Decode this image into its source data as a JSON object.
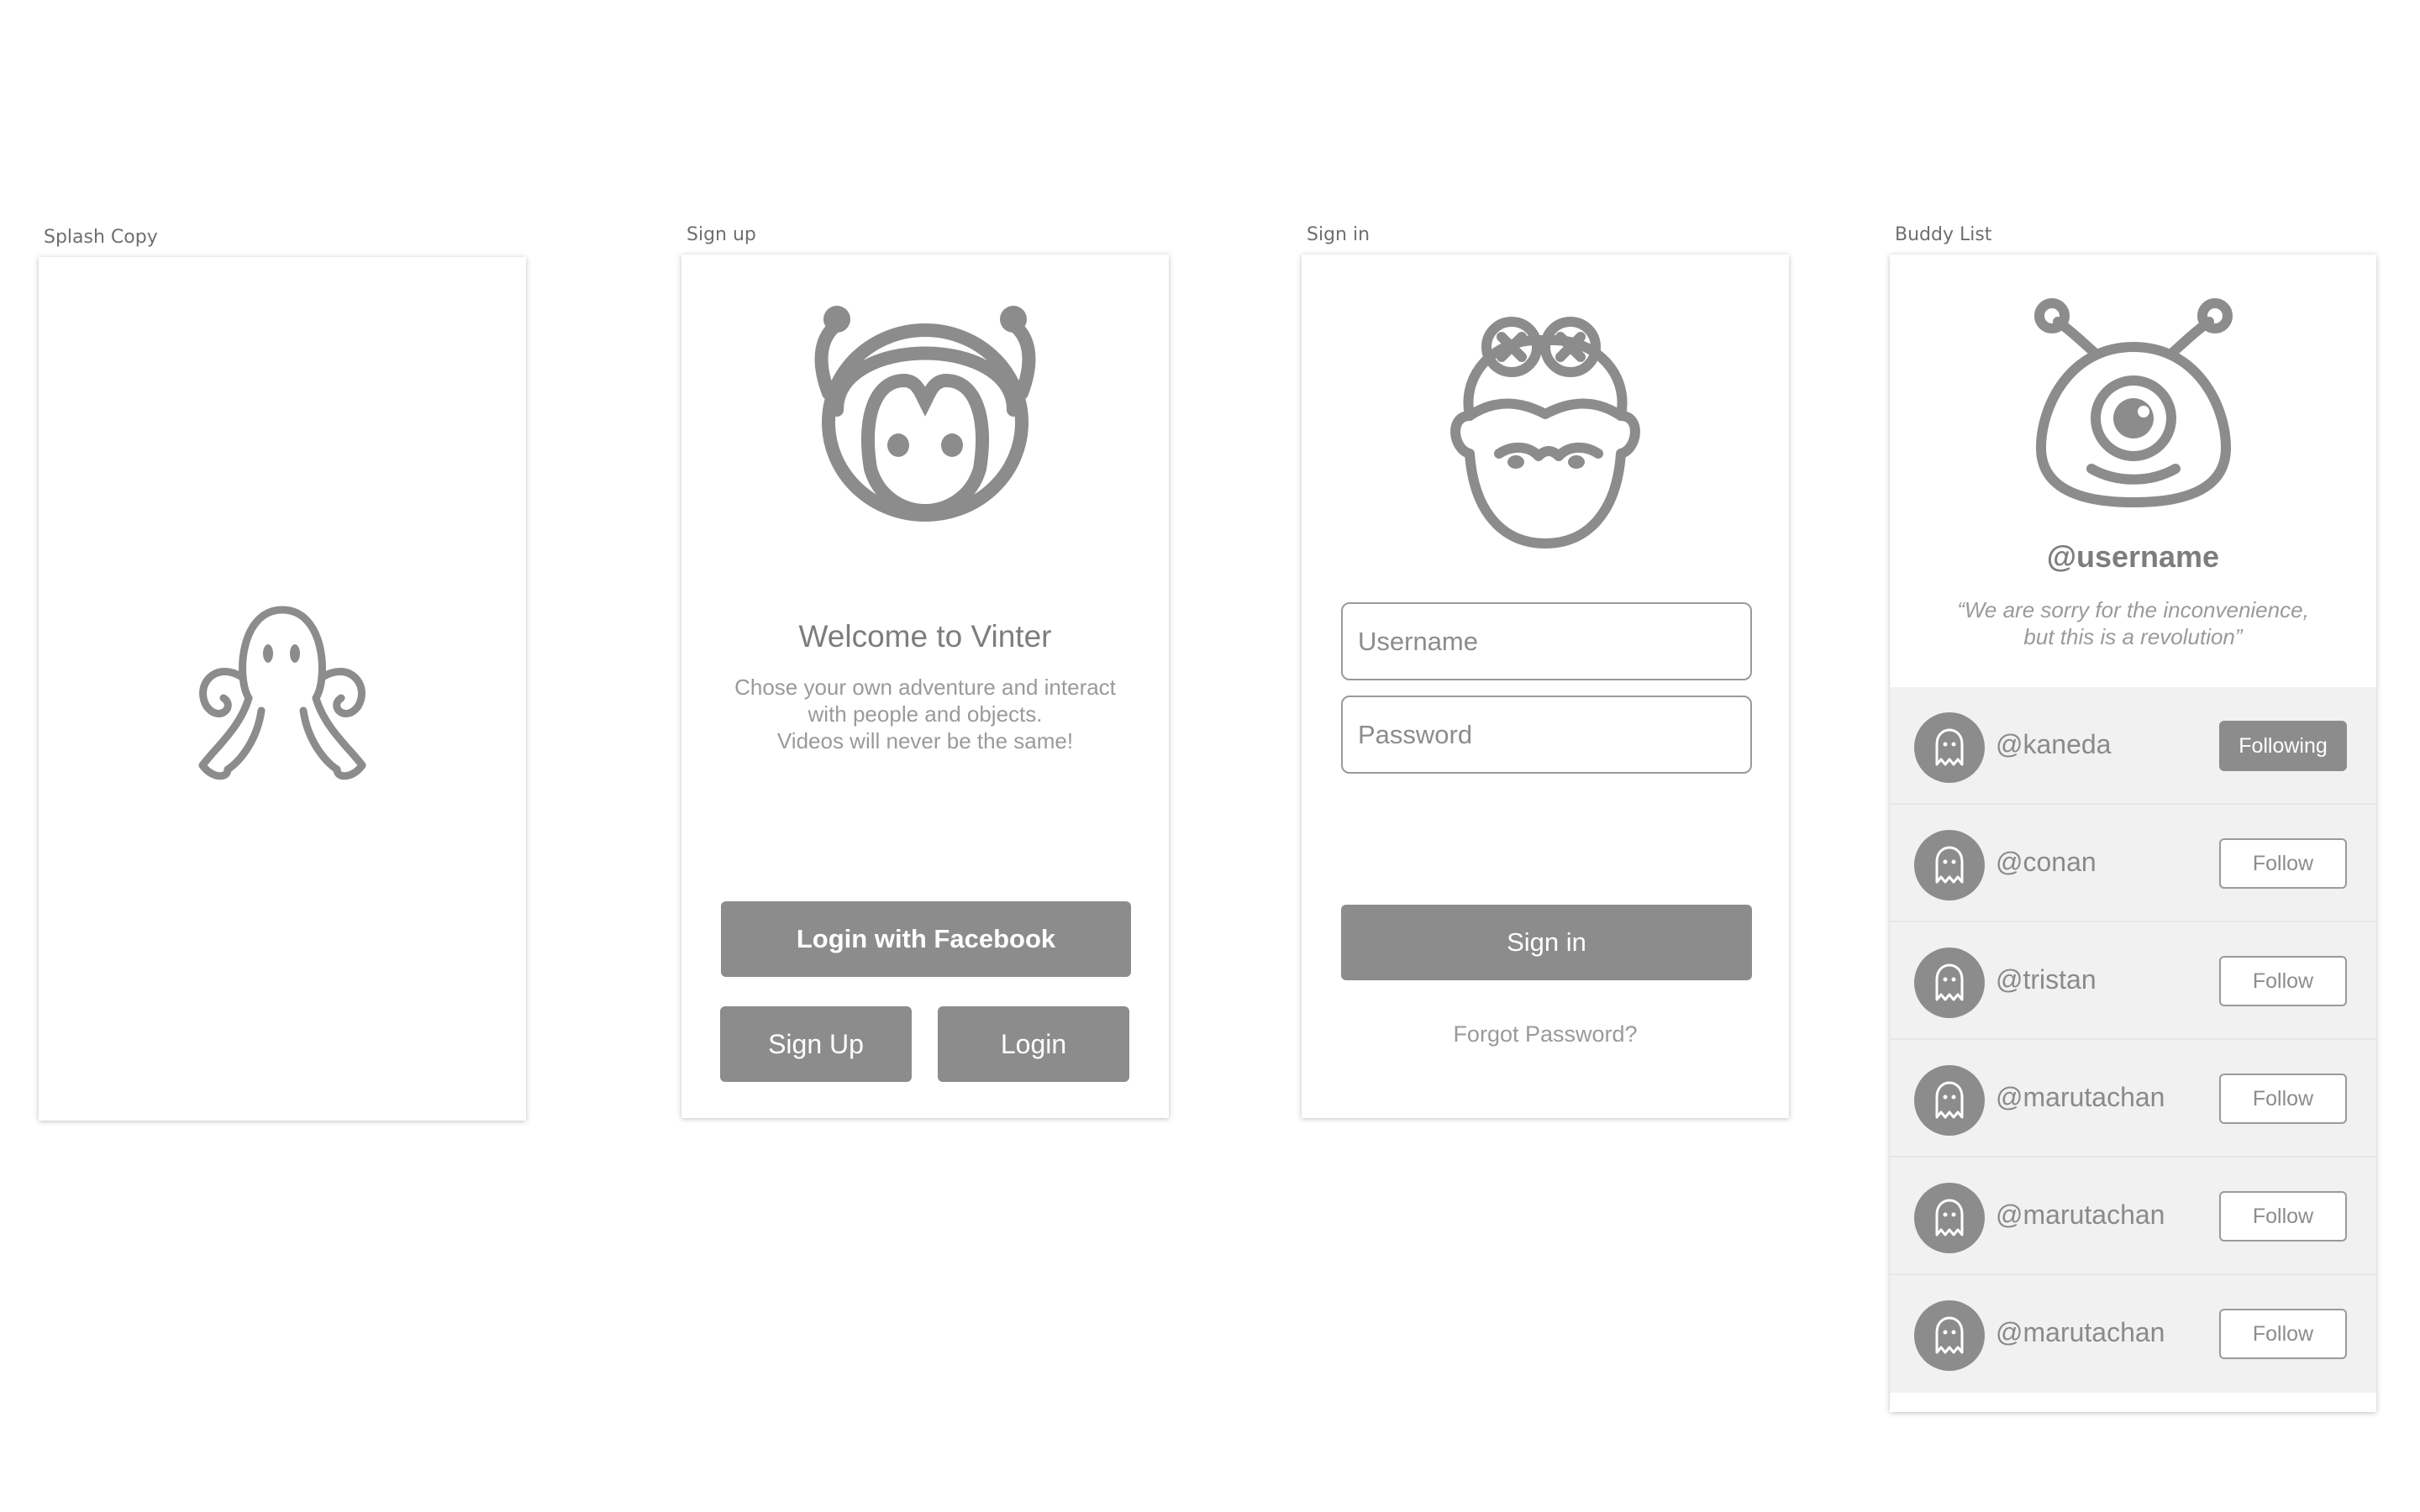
{
  "colors": {
    "primary_gray": "#8c8c8c",
    "row_bg": "#f1f1f1",
    "canvas_bg": "#ffffff"
  },
  "artboards": {
    "splash": {
      "label": "Splash Copy",
      "icon": "octopus-icon"
    },
    "signup": {
      "label": "Sign up",
      "icon": "monkey-mascot-icon",
      "title": "Welcome to Vinter",
      "description_line1": "Chose your own adventure and interact",
      "description_line2": "with people and objects.",
      "description_line3": "Videos will never be the same!",
      "facebook_button": "Login with Facebook",
      "signup_button": "Sign Up",
      "login_button": "Login"
    },
    "signin": {
      "label": "Sign in",
      "icon": "girl-avatar-icon",
      "username_placeholder": "Username",
      "password_placeholder": "Password",
      "signin_button": "Sign in",
      "forgot_password": "Forgot Password?"
    },
    "buddy": {
      "label": "Buddy List",
      "icon": "cyclops-alien-icon",
      "username": "@username",
      "quote_line1": "“We are sorry for the inconvenience,",
      "quote_line2": "but this is a revolution”",
      "buddies": [
        {
          "name": "@kaneda",
          "button": "Following",
          "following": true
        },
        {
          "name": "@conan",
          "button": "Follow",
          "following": false
        },
        {
          "name": "@tristan",
          "button": "Follow",
          "following": false
        },
        {
          "name": "@marutachan",
          "button": "Follow",
          "following": false
        },
        {
          "name": "@marutachan",
          "button": "Follow",
          "following": false
        },
        {
          "name": "@marutachan",
          "button": "Follow",
          "following": false
        }
      ]
    }
  }
}
